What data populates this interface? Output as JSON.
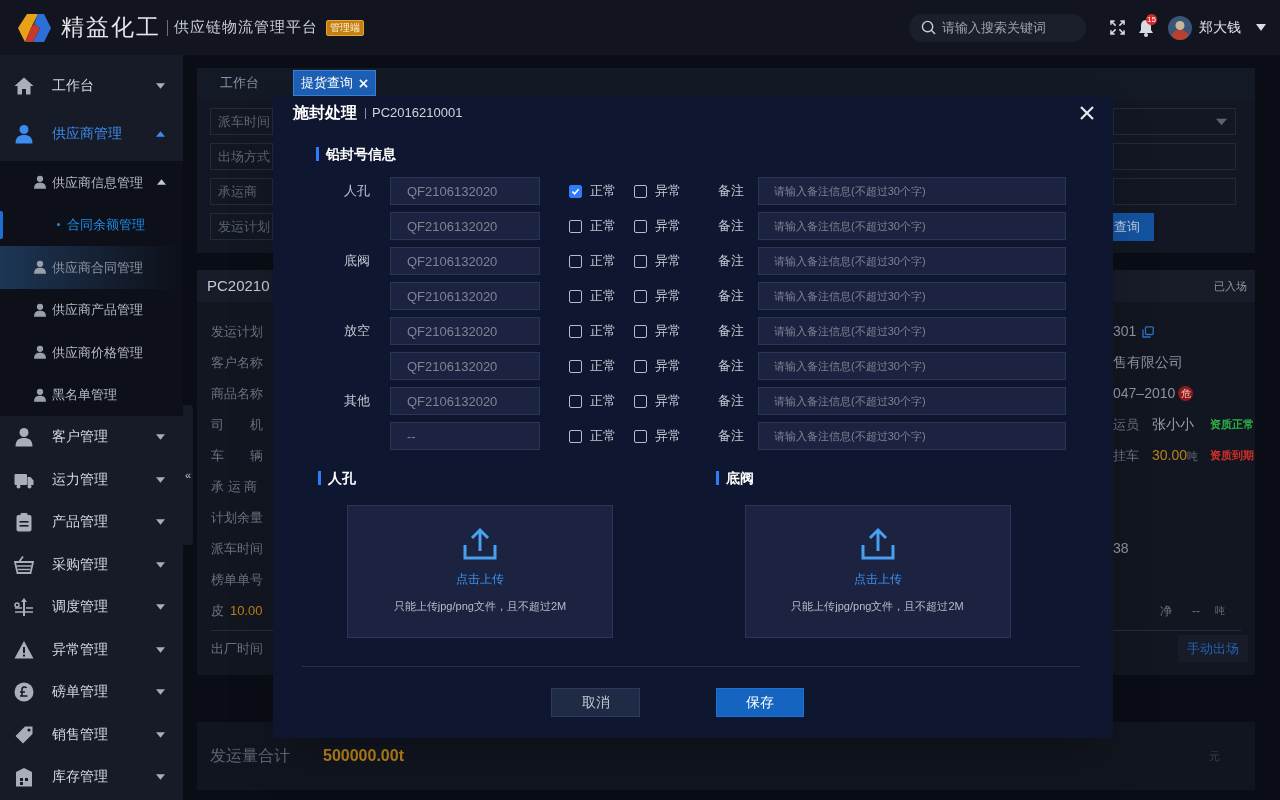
{
  "header": {
    "logo_text": "精益化工",
    "subtitle": "供应链物流管理平台",
    "badge": "管理端",
    "search": {
      "placeholder": "请输入搜索关键词"
    },
    "notification_count": "15",
    "user_name": "郑大钱"
  },
  "sidebar": {
    "collapse_toggle": "«",
    "items": [
      {
        "label": "工作台",
        "kind": "home",
        "expanded": false,
        "selected": false
      },
      {
        "label": "供应商管理",
        "kind": "person",
        "expanded": true,
        "selected": true,
        "children": [
          {
            "label": "供应商信息管理",
            "expanded": true,
            "highlighted": false,
            "children": [
              {
                "label": "合同余额管理",
                "selected": true
              }
            ]
          },
          {
            "label": "供应商合同管理",
            "highlighted": true
          },
          {
            "label": "供应商产品管理",
            "highlighted": false
          },
          {
            "label": "供应商价格管理",
            "highlighted": false
          },
          {
            "label": "黑名单管理",
            "highlighted": false
          }
        ]
      },
      {
        "label": "客户管理",
        "kind": "person",
        "expanded": false,
        "selected": false
      },
      {
        "label": "运力管理",
        "kind": "truck",
        "expanded": false,
        "selected": false
      },
      {
        "label": "产品管理",
        "kind": "clipboard",
        "expanded": false,
        "selected": false
      },
      {
        "label": "采购管理",
        "kind": "basket",
        "expanded": false,
        "selected": false
      },
      {
        "label": "调度管理",
        "kind": "dispatch",
        "expanded": false,
        "selected": false
      },
      {
        "label": "异常管理",
        "kind": "warning",
        "expanded": false,
        "selected": false
      },
      {
        "label": "磅单管理",
        "kind": "pound",
        "expanded": false,
        "selected": false
      },
      {
        "label": "销售管理",
        "kind": "tag",
        "expanded": false,
        "selected": false
      },
      {
        "label": "库存管理",
        "kind": "warehouse",
        "expanded": false,
        "selected": false
      }
    ]
  },
  "tabs": [
    {
      "label": "工作台",
      "selected": false,
      "closable": false
    },
    {
      "label": "提货查询",
      "selected": true,
      "closable": true
    }
  ],
  "filters": {
    "labels": [
      "派车时间",
      "出场方式",
      "承运商",
      "发运计划"
    ],
    "query_button": "查询"
  },
  "record": {
    "id": "PC20210",
    "status": "已入场",
    "rows": [
      {
        "label": "发运计划",
        "right": {
          "kind": "copy",
          "text": "301"
        }
      },
      {
        "label": "客户名称",
        "right": {
          "kind": "text",
          "text": "售有限公司"
        }
      },
      {
        "label": "商品名称",
        "right": {
          "kind": "hazard",
          "text": "047–2010",
          "badge": "危"
        }
      },
      {
        "label": "司　　机",
        "right": {
          "kind": "qualification",
          "label": "运员",
          "value": "张小小",
          "tag": "资质正常",
          "color": "#2fae4a"
        }
      },
      {
        "label": "车　　辆",
        "right": {
          "kind": "qualification",
          "label": "挂车",
          "value": "30.00",
          "unit": "吨",
          "tag": "资质到期",
          "color": "#d2302a"
        }
      },
      {
        "label": "承 运 商"
      },
      {
        "label": "计划余量"
      },
      {
        "label": "派车时间",
        "right": {
          "kind": "text",
          "text": "38"
        }
      },
      {
        "label": "榜单单号"
      },
      {
        "label": "皮",
        "value": "10.00",
        "right": {
          "kind": "net",
          "label": "净",
          "value": "--",
          "unit": "吨"
        }
      }
    ],
    "exit_label": "出厂时间",
    "exit_button": "手动出场"
  },
  "totals": {
    "label": "发运量合计",
    "value": "500000.00t",
    "unit": "元"
  },
  "modal": {
    "title": "施封处理",
    "code": "PC2016210001",
    "section_title": "铅封号信息",
    "seal_rows": [
      {
        "group": "人孔",
        "code": "QF2106132020",
        "checks": [
          {
            "label": "正常",
            "checked": true
          },
          {
            "label": "异常",
            "checked": false
          }
        ],
        "note_label": "备注",
        "note_placeholder": "请输入备注信息(不超过30个字)"
      },
      {
        "code": "QF2106132020",
        "checks": [
          {
            "label": "正常",
            "checked": false
          },
          {
            "label": "异常",
            "checked": false
          }
        ],
        "note_label": "备注",
        "note_placeholder": "请输入备注信息(不超过30个字)"
      },
      {
        "group": "底阀",
        "code": "QF2106132020",
        "checks": [
          {
            "label": "正常",
            "checked": false
          },
          {
            "label": "异常",
            "checked": false
          }
        ],
        "note_label": "备注",
        "note_placeholder": "请输入备注信息(不超过30个字)"
      },
      {
        "code": "QF2106132020",
        "checks": [
          {
            "label": "正常",
            "checked": false
          },
          {
            "label": "异常",
            "checked": false
          }
        ],
        "note_label": "备注",
        "note_placeholder": "请输入备注信息(不超过30个字)"
      },
      {
        "group": "放空",
        "code": "QF2106132020",
        "checks": [
          {
            "label": "正常",
            "checked": false
          },
          {
            "label": "异常",
            "checked": false
          }
        ],
        "note_label": "备注",
        "note_placeholder": "请输入备注信息(不超过30个字)"
      },
      {
        "code": "QF2106132020",
        "checks": [
          {
            "label": "正常",
            "checked": false
          },
          {
            "label": "异常",
            "checked": false
          }
        ],
        "note_label": "备注",
        "note_placeholder": "请输入备注信息(不超过30个字)"
      },
      {
        "group": "其他",
        "code": "QF2106132020",
        "checks": [
          {
            "label": "正常",
            "checked": false
          },
          {
            "label": "异常",
            "checked": false
          }
        ],
        "note_label": "备注",
        "note_placeholder": "请输入备注信息(不超过30个字)"
      },
      {
        "code": "--",
        "checks": [
          {
            "label": "正常",
            "checked": false
          },
          {
            "label": "异常",
            "checked": false
          }
        ],
        "note_label": "备注",
        "note_placeholder": "请输入备注信息(不超过30个字)"
      }
    ],
    "uploads": [
      {
        "title": "人孔",
        "action": "点击上传",
        "hint": "只能上传jpg/png文件，且不超过2M"
      },
      {
        "title": "底阀",
        "action": "点击上传",
        "hint": "只能上传jpg/png文件，且不超过2M"
      }
    ],
    "buttons": [
      {
        "label": "取消",
        "kind": "secondary"
      },
      {
        "label": "保存",
        "kind": "primary"
      }
    ]
  }
}
